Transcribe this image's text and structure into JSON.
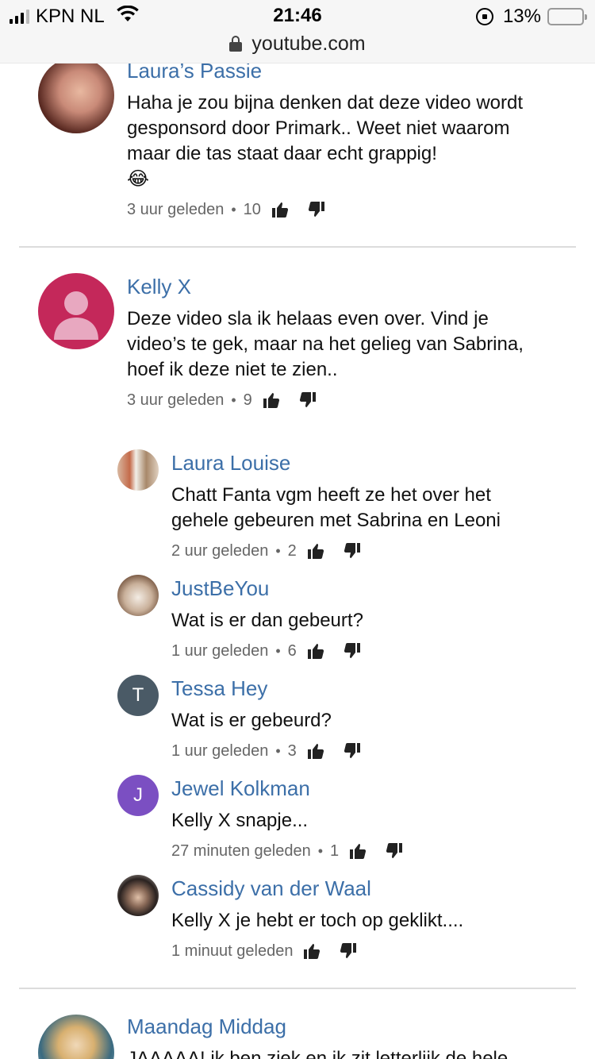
{
  "status_bar": {
    "carrier": "KPN NL",
    "time": "21:46",
    "battery": "13%",
    "url": "youtube.com"
  },
  "comments": [
    {
      "author": "Laura’s Passie",
      "text": "Haha je zou bijna denken dat deze video wordt gesponsord door Primark.. Weet niet waarom maar die tas staat daar echt grappig!",
      "emoji": "😂",
      "time": "3 uur geleden",
      "likes": "10"
    },
    {
      "author": "Kelly X",
      "text": "Deze video sla ik helaas even over. Vind je video’s te gek, maar na het gelieg van Sabrina, hoef ik deze niet te zien..",
      "time": "3 uur geleden",
      "likes": "9"
    }
  ],
  "replies": [
    {
      "author": "Laura Louise",
      "text": "Chatt Fanta vgm heeft ze het over het gehele gebeuren met Sabrina en Leoni",
      "time": "2 uur geleden",
      "likes": "2"
    },
    {
      "author": "JustBeYou",
      "text": "Wat is er dan gebeurt?",
      "time": "1 uur geleden",
      "likes": "6"
    },
    {
      "author": "Tessa Hey",
      "initial": "T",
      "text": "Wat is er gebeurd?",
      "time": "1 uur geleden",
      "likes": "3"
    },
    {
      "author": "Jewel Kolkman",
      "initial": "J",
      "text": "Kelly X snapje...",
      "time": "27 minuten geleden",
      "likes": "1"
    },
    {
      "author": "Cassidy van der Waal",
      "text": "Kelly X je hebt er toch op geklikt....",
      "time": "1 minuut geleden",
      "likes": ""
    }
  ],
  "next_comment": {
    "author": "Maandag Middag",
    "text": "JAAAAA! ik ben ziek en ik zit letterlijk de hele"
  },
  "colors": {
    "link_blue": "#3c6fa8",
    "kelly_avatar": "#c4285a",
    "tessa_avatar": "#4a5a66",
    "jewel_avatar": "#7b4fc2"
  }
}
